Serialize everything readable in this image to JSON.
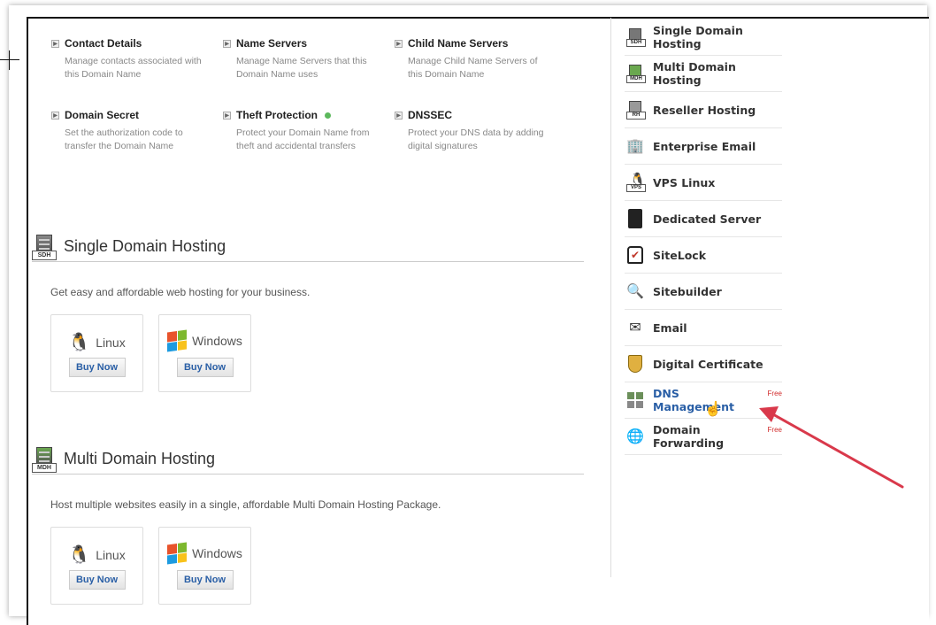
{
  "options": [
    {
      "title": "Contact Details",
      "desc": "Manage contacts associated with this Domain Name"
    },
    {
      "title": "Name Servers",
      "desc": "Manage Name Servers that this Domain Name uses"
    },
    {
      "title": "Child Name Servers",
      "desc": "Manage Child Name Servers of this Domain Name"
    },
    {
      "title": "Domain Secret",
      "desc": "Set the authorization code to transfer the Domain Name"
    },
    {
      "title": "Theft Protection",
      "desc": "Protect your Domain Name from theft and accidental transfers"
    },
    {
      "title": "DNSSEC",
      "desc": "Protect your DNS data by adding digital signatures"
    }
  ],
  "sections": [
    {
      "title": "Single Domain Hosting",
      "tag": "SDH",
      "desc": "Get easy and affordable web hosting for your business.",
      "linux": "Linux",
      "windows": "Windows",
      "buy": "Buy Now"
    },
    {
      "title": "Multi Domain Hosting",
      "tag": "MDH",
      "desc": "Host multiple websites easily in a single, affordable Multi Domain Hosting Package.",
      "linux": "Linux",
      "windows": "Windows",
      "buy": "Buy Now"
    }
  ],
  "sidebar": {
    "items": [
      {
        "label": "Single Domain Hosting",
        "icon": "sdh-server-icon",
        "tag": "SDH"
      },
      {
        "label": "Multi Domain Hosting",
        "icon": "mdh-server-icon",
        "tag": "MDH"
      },
      {
        "label": "Reseller Hosting",
        "icon": "rh-server-icon",
        "tag": "RH"
      },
      {
        "label": "Enterprise Email",
        "icon": "enterprise-email-icon"
      },
      {
        "label": "VPS Linux",
        "icon": "vps-linux-icon",
        "tag": "VPS"
      },
      {
        "label": "Dedicated Server",
        "icon": "dedicated-server-icon"
      },
      {
        "label": "SiteLock",
        "icon": "sitelock-icon"
      },
      {
        "label": "Sitebuilder",
        "icon": "sitebuilder-icon"
      },
      {
        "label": "Email",
        "icon": "email-icon"
      },
      {
        "label": "Digital Certificate",
        "icon": "digital-certificate-icon"
      },
      {
        "label": "DNS Management",
        "icon": "dns-management-icon",
        "badge": "Free"
      },
      {
        "label": "Domain Forwarding",
        "icon": "domain-forwarding-icon",
        "badge": "Free"
      }
    ]
  },
  "colors": {
    "link": "#2a5fa6",
    "free_badge": "#d12b2b",
    "arrow": "#d9394b",
    "status_dot": "#5cb85c"
  }
}
